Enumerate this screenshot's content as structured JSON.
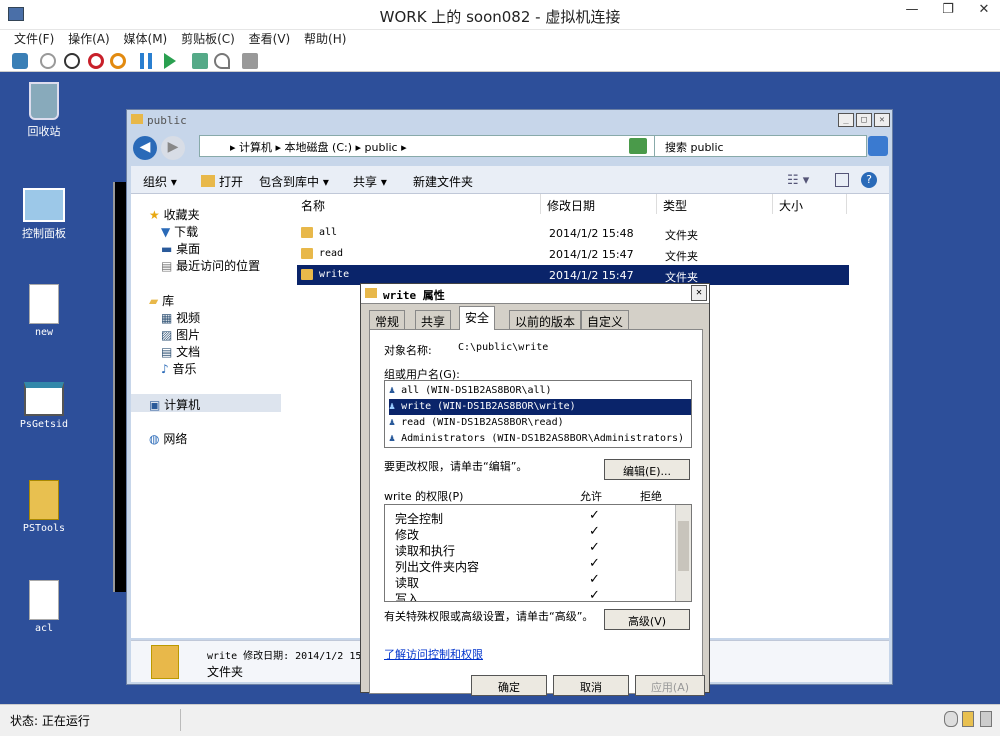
{
  "vm": {
    "title": "WORK 上的 soon082 - 虚拟机连接",
    "menu": [
      "文件(F)",
      "操作(A)",
      "媒体(M)",
      "剪贴板(C)",
      "查看(V)",
      "帮助(H)"
    ],
    "status": "状态: 正在运行"
  },
  "desktop": {
    "icons": [
      "回收站",
      "控制面板",
      "new",
      "PsGetsid",
      "PSTools",
      "acl"
    ]
  },
  "explorer": {
    "title": "public",
    "address": "▸ 计算机 ▸ 本地磁盘 (C:) ▸ public ▸",
    "search_placeholder": "搜索 public",
    "toolbar": [
      "组织 ▾",
      "打开",
      "包含到库中 ▾",
      "共享 ▾",
      "新建文件夹"
    ],
    "nav": {
      "favorites": "收藏夹",
      "fav_items": [
        "下载",
        "桌面",
        "最近访问的位置"
      ],
      "libraries": "库",
      "lib_items": [
        "视频",
        "图片",
        "文档",
        "音乐"
      ],
      "computer": "计算机",
      "network": "网络"
    },
    "columns": [
      "名称",
      "修改日期",
      "类型",
      "大小"
    ],
    "files": [
      {
        "name": "all",
        "date": "2014/1/2 15:48",
        "type": "文件夹"
      },
      {
        "name": "read",
        "date": "2014/1/2 15:47",
        "type": "文件夹"
      },
      {
        "name": "write",
        "date": "2014/1/2 15:47",
        "type": "文件夹"
      }
    ],
    "details": {
      "line1": "write  修改日期: 2014/1/2 15",
      "line2": "文件夹"
    }
  },
  "props": {
    "title": "write 属性",
    "tabs": [
      "常规",
      "共享",
      "安全",
      "以前的版本",
      "自定义"
    ],
    "object_label": "对象名称:",
    "object_value": "C:\\public\\write",
    "groups_label": "组或用户名(G):",
    "groups": [
      "all (WIN-DS1B2AS8BOR\\all)",
      "write (WIN-DS1B2AS8BOR\\write)",
      "read (WIN-DS1B2AS8BOR\\read)",
      "Administrators (WIN-DS1B2AS8BOR\\Administrators)"
    ],
    "edit_hint": "要更改权限，请单击“编辑”。",
    "edit_button": "编辑(E)...",
    "perm_label": "write 的权限(P)",
    "allow": "允许",
    "deny": "拒绝",
    "perms": [
      "完全控制",
      "修改",
      "读取和执行",
      "列出文件夹内容",
      "读取",
      "写入"
    ],
    "checkmark": "✓",
    "adv_hint": "有关特殊权限或高级设置，请单击“高级”。",
    "adv_button": "高级(V)",
    "link": "了解访问控制和权限",
    "ok": "确定",
    "cancel": "取消",
    "apply": "应用(A)"
  }
}
